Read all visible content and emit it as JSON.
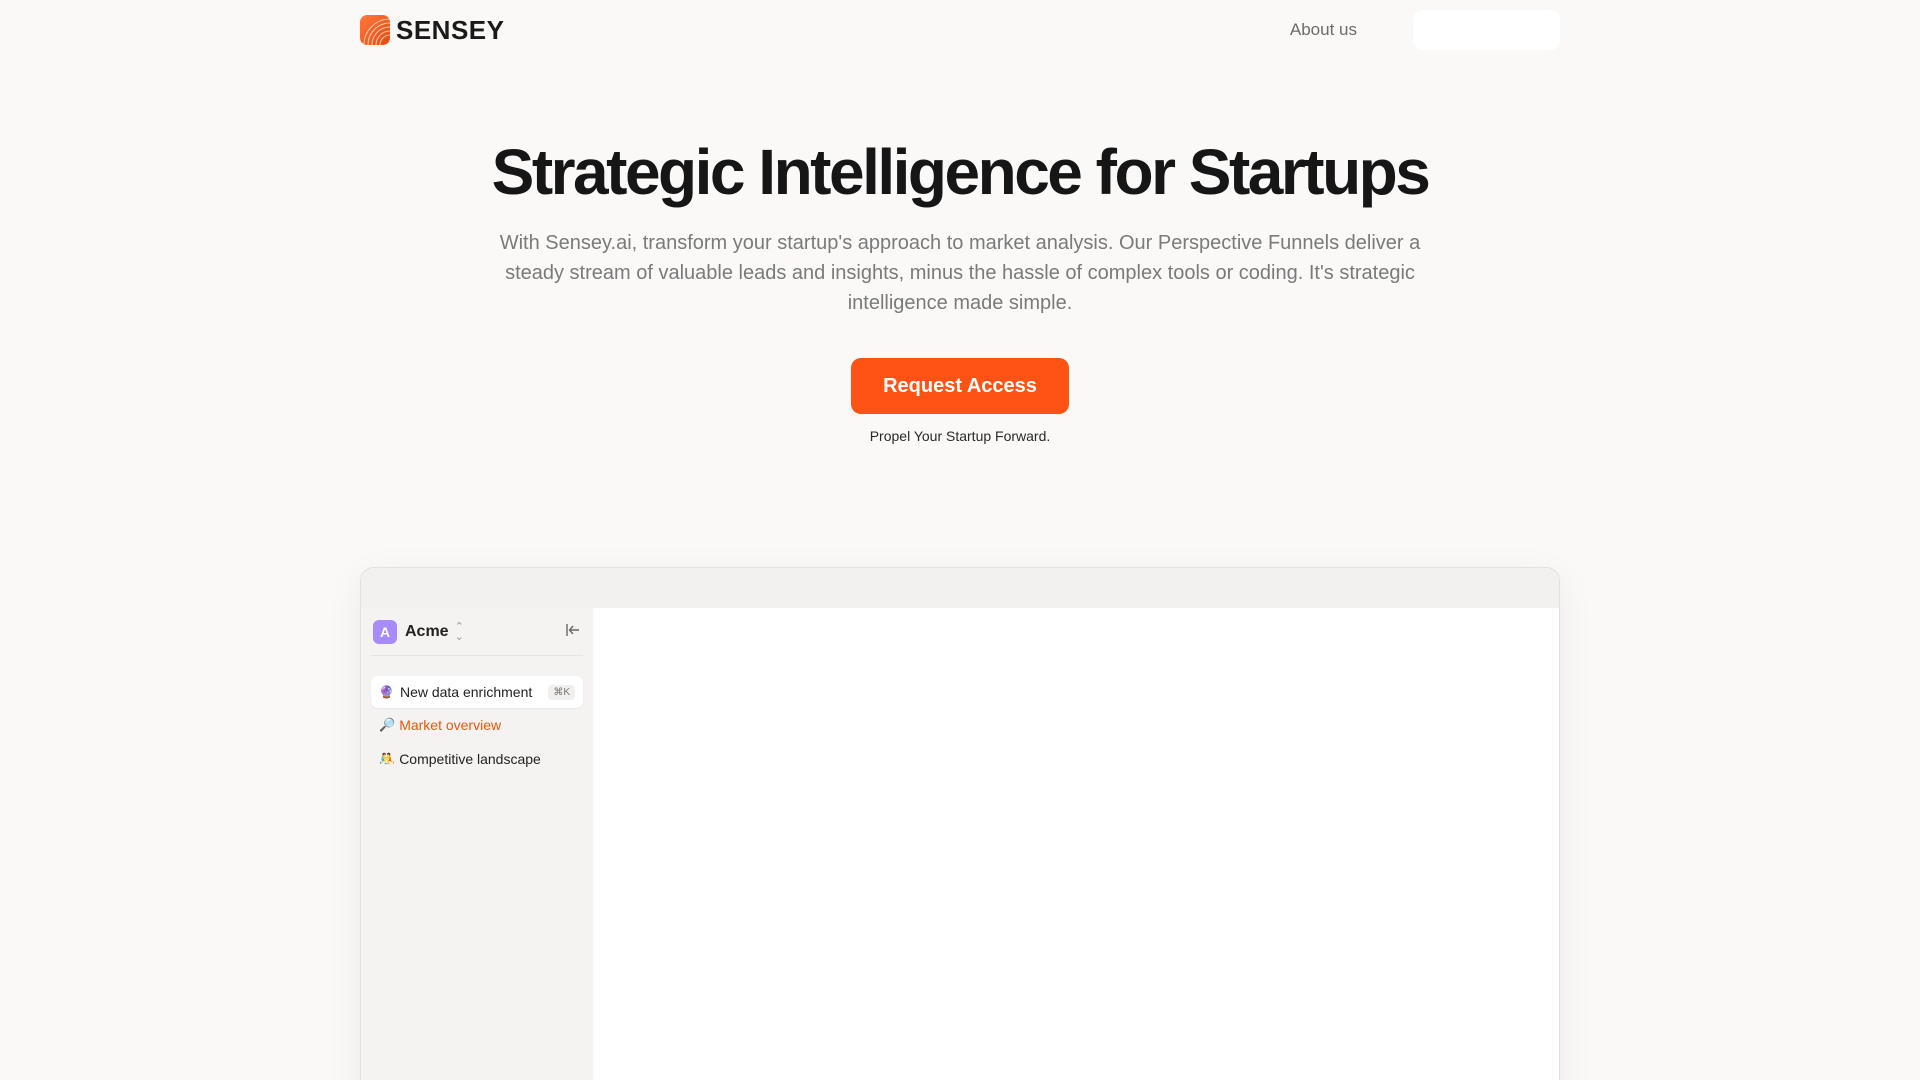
{
  "header": {
    "brand_name": "SENSEY",
    "nav_about": "About us",
    "colors": {
      "brand": "#fe5314"
    }
  },
  "hero": {
    "title": "Strategic Intelligence for Startups",
    "subtitle": "With Sensey.ai, transform your startup's approach to market analysis. Our Perspective Funnels deliver a steady stream of valuable leads and insights, minus the hassle of complex tools or coding. It's strategic intelligence made simple.",
    "cta_label": "Request Access",
    "cta_note": "Propel Your Startup Forward."
  },
  "preview": {
    "workspace": {
      "avatar_letter": "A",
      "name": "Acme",
      "switch_icon": "chevron-up-down-icon",
      "collapse_icon": "collapse-sidebar-icon"
    },
    "new_button": {
      "icon": "🔮",
      "label": "New data enrichment",
      "shortcut": "⌘K"
    },
    "nav_items": [
      {
        "icon": "🔎",
        "label": "Market overview",
        "active": true
      },
      {
        "icon": "🤼",
        "label": "Competitive landscape",
        "active": false
      }
    ]
  }
}
